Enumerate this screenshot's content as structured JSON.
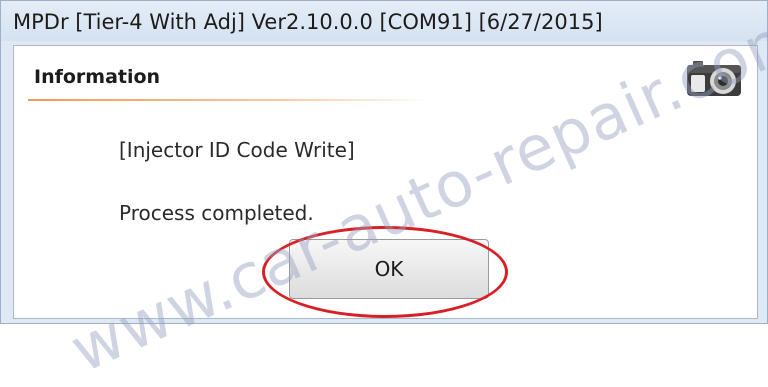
{
  "window": {
    "title": "MPDr [Tier-4 With Adj] Ver2.10.0.0 [COM91] [6/27/2015]"
  },
  "dialog": {
    "heading": "Information",
    "header_icon": "camera-icon",
    "message_title": "[Injector ID Code Write]",
    "message_body": "Process completed.",
    "ok_label": "OK",
    "highlight_color": "#d91f26"
  },
  "watermark": {
    "text": "www.car-auto-repair.com"
  }
}
